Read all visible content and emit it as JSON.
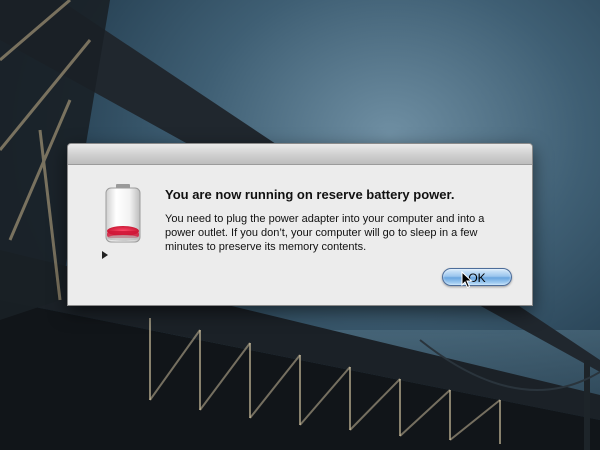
{
  "desktop": {
    "background_colors": {
      "sky_light": "#6f8fa3",
      "sky_dark": "#213a4c",
      "bridge_steel": "#1b2127"
    }
  },
  "dialog": {
    "icon_name": "battery-low-icon",
    "title": "You are now running on reserve battery power.",
    "message": "You need to plug the power adapter into your computer and into a power outlet. If you don’t, your computer will go to sleep in a few minutes to preserve its memory contents.",
    "ok_label": "OK",
    "accent_color": "#6aa6e0"
  },
  "cursor": {
    "icon_name": "arrow-cursor-icon"
  }
}
